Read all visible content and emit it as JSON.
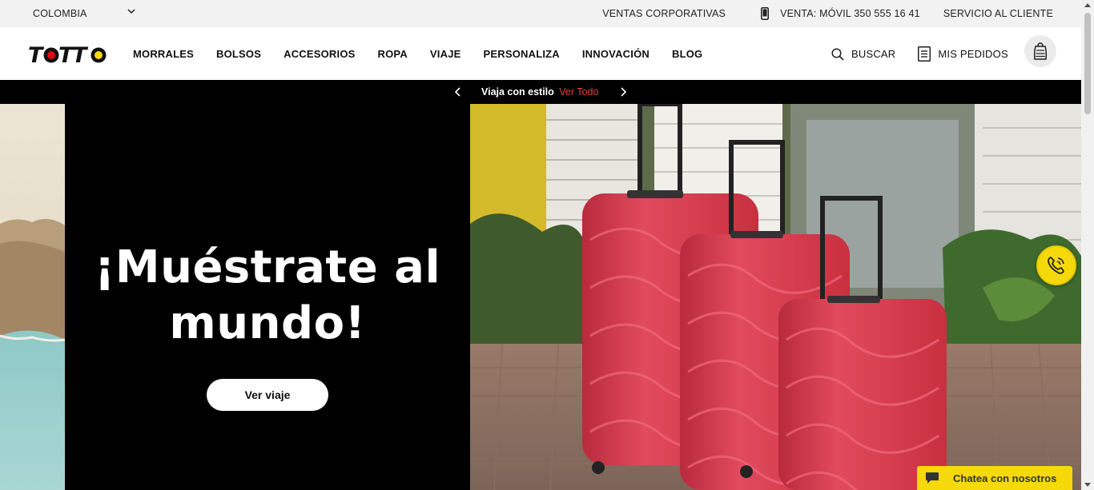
{
  "topbar": {
    "country": "COLOMBIA",
    "corporate_sales": "VENTAS CORPORATIVAS",
    "phone_sales": "VENTA: MÓVIL 350 555 16 41",
    "customer_service": "SERVICIO AL CLIENTE",
    "icons": {
      "country_toggle": "chevron-down-icon",
      "phone": "mobile-phone-icon"
    }
  },
  "navbar": {
    "logo_text": "TOTTO",
    "menu": [
      "MORRALES",
      "BOLSOS",
      "ACCESORIOS",
      "ROPA",
      "VIAJE",
      "PERSONALIZA",
      "INNOVACIÓN",
      "BLOG"
    ],
    "search_label": "BUSCAR",
    "orders_label": "MIS PEDIDOS",
    "icons": {
      "search": "search-icon",
      "orders": "document-list-icon",
      "bag": "shopping-bag-icon"
    }
  },
  "promo": {
    "text": "Viaja con estilo",
    "link": "Ver Todo",
    "link_color": "#e8423a"
  },
  "hero": {
    "headline": "¡Muéstrate al mundo!",
    "cta": "Ver viaje",
    "panel_color": "#000000",
    "suitcase_color": "#d8354a"
  },
  "widgets": {
    "call_icon": "phone-call-icon",
    "chat_label": "Chatea con nosotros",
    "chat_icon": "chat-bubble-icon",
    "accent": "#f5d90a"
  }
}
